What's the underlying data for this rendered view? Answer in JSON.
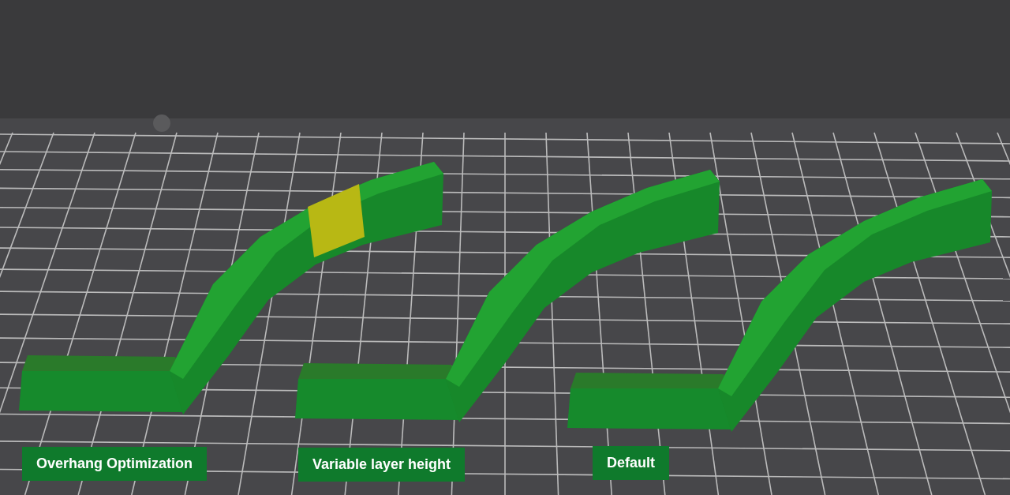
{
  "models": [
    {
      "label": "Overhang Optimization",
      "highlighted": true
    },
    {
      "label": "Variable layer height",
      "highlighted": false
    },
    {
      "label": "Default",
      "highlighted": false
    }
  ]
}
